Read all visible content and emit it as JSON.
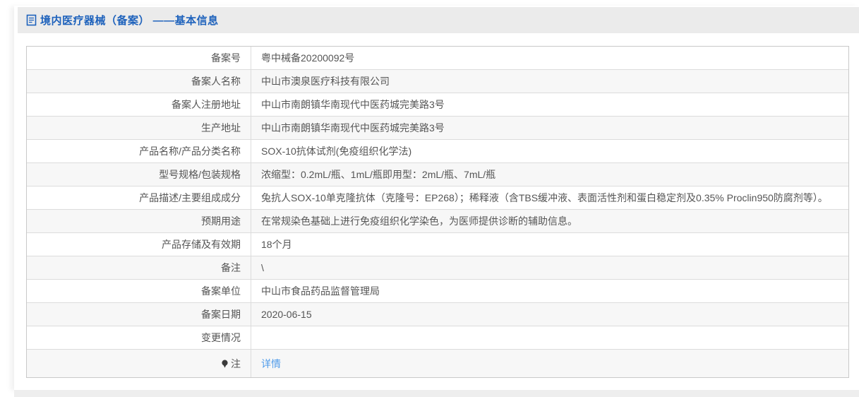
{
  "header": {
    "icon": "document-icon",
    "title": "境内医疗器械（备案） ——基本信息"
  },
  "table": {
    "rows": [
      {
        "label": "备案号",
        "value": "粤中械备20200092号"
      },
      {
        "label": "备案人名称",
        "value": "中山市澳泉医疗科技有限公司"
      },
      {
        "label": "备案人注册地址",
        "value": "中山市南朗镇华南现代中医药城完美路3号"
      },
      {
        "label": "生产地址",
        "value": "中山市南朗镇华南现代中医药城完美路3号"
      },
      {
        "label": "产品名称/产品分类名称",
        "value": "SOX-10抗体试剂(免疫组织化学法)"
      },
      {
        "label": "型号规格/包装规格",
        "value": "浓缩型：0.2mL/瓶、1mL/瓶即用型：2mL/瓶、7mL/瓶"
      },
      {
        "label": "产品描述/主要组成成分",
        "value": "兔抗人SOX-10单克隆抗体（克隆号：EP268）；稀释液（含TBS缓冲液、表面活性剂和蛋白稳定剂及0.35% Proclin950防腐剂等）。"
      },
      {
        "label": "预期用途",
        "value": "在常规染色基础上进行免疫组织化学染色，为医师提供诊断的辅助信息。"
      },
      {
        "label": "产品存储及有效期",
        "value": "18个月"
      },
      {
        "label": "备注",
        "value": "\\"
      },
      {
        "label": "备案单位",
        "value": "中山市食品药品监督管理局"
      },
      {
        "label": "备案日期",
        "value": "2020-06-15"
      },
      {
        "label": "变更情况",
        "value": ""
      },
      {
        "label": "注",
        "label_icon": "bulb-icon",
        "value": "",
        "link": "详情"
      }
    ]
  },
  "colors": {
    "title_blue": "#1e62bc",
    "link_blue": "#4f9bea",
    "alt_row_bg": "#f7f7f7",
    "table_border": "#c9c9c9",
    "row_border": "#dcdcdc",
    "header_bg": "#ebebeb",
    "text": "#555555"
  }
}
